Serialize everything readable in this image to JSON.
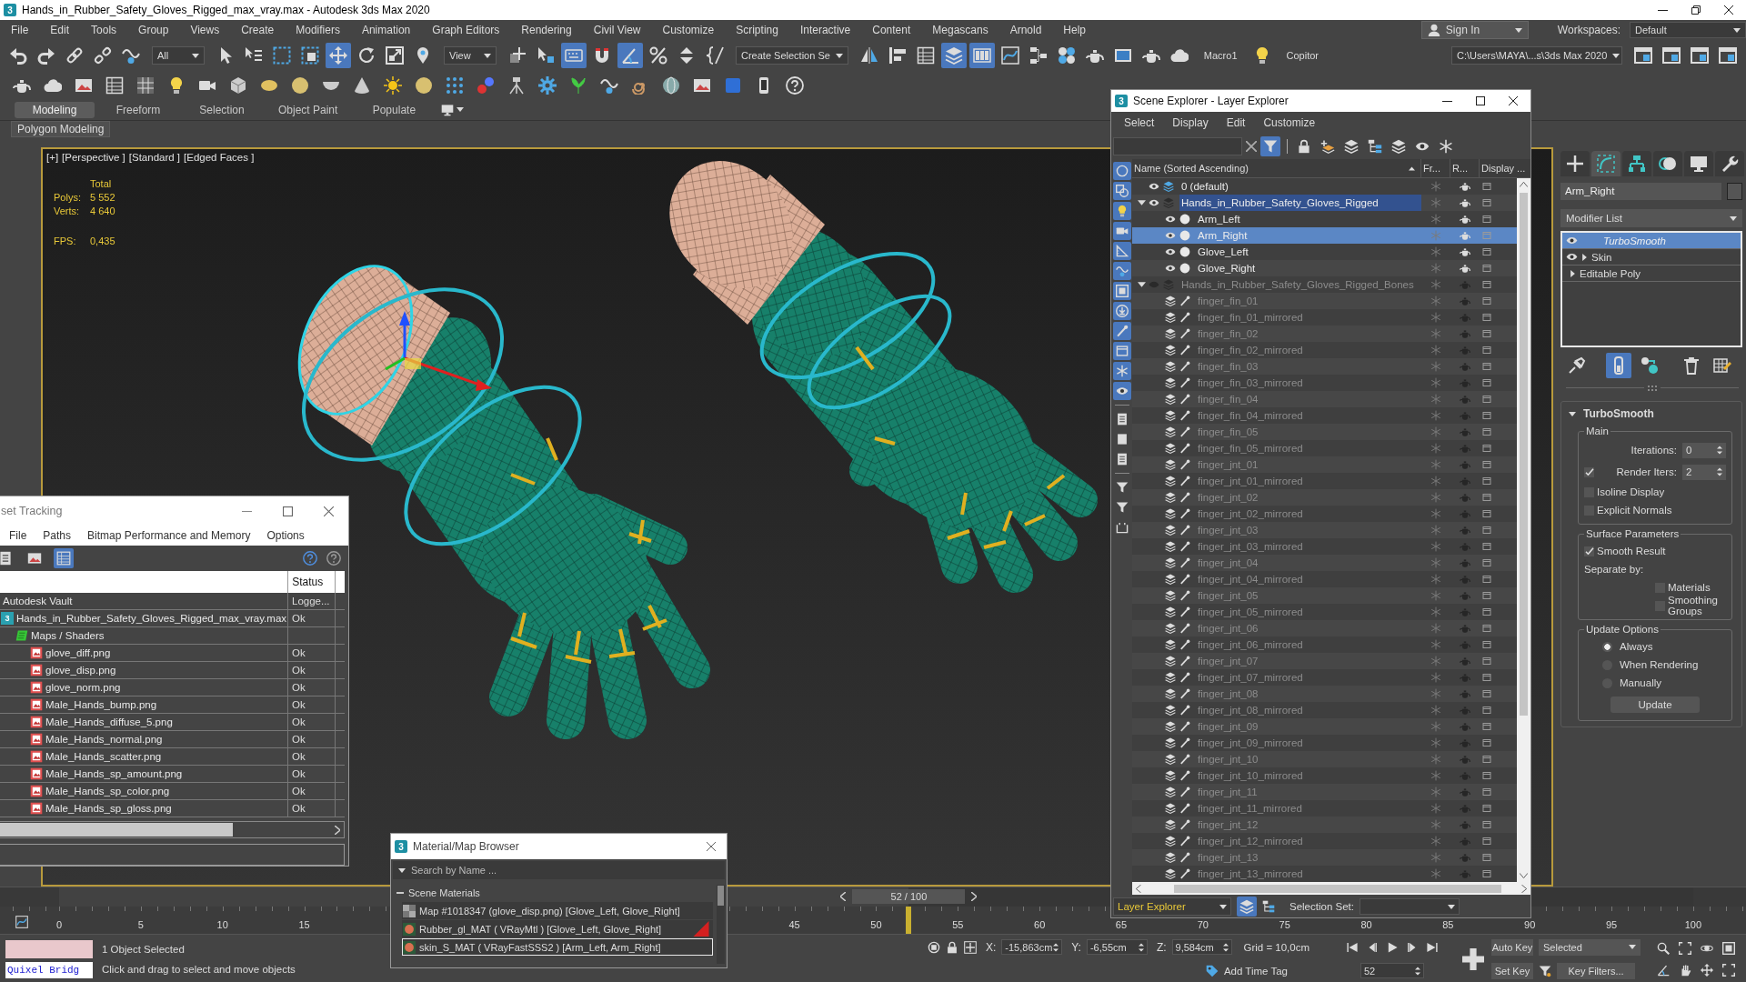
{
  "window": {
    "logo": "3",
    "title": "Hands_in_Rubber_Safety_Gloves_Rigged_max_vray.max - Autodesk 3ds Max 2020"
  },
  "menu": [
    "File",
    "Edit",
    "Tools",
    "Group",
    "Views",
    "Create",
    "Modifiers",
    "Animation",
    "Graph Editors",
    "Rendering",
    "Civil View",
    "Customize",
    "Scripting",
    "Interactive",
    "Content",
    "Megascans",
    "Arnold",
    "Help"
  ],
  "account": {
    "label": "Sign In"
  },
  "workspaces": {
    "label": "Workspaces:",
    "value": "Default"
  },
  "main_toolbar": [
    {
      "kind": "undo",
      "on": false
    },
    {
      "kind": "redo",
      "on": false
    },
    {
      "kind": "link",
      "on": false
    },
    {
      "kind": "unlink",
      "on": false
    },
    {
      "kind": "wave",
      "on": false
    },
    {
      "kind": "dropdown",
      "value": "All",
      "on": false
    },
    {
      "kind": "cursor",
      "on": false
    },
    {
      "kind": "namelist",
      "on": false
    },
    {
      "kind": "rectangle",
      "on": false
    },
    {
      "kind": "crossing",
      "on": false
    },
    {
      "kind": "move",
      "on": true
    },
    {
      "kind": "rotate",
      "on": false
    },
    {
      "kind": "scale",
      "on": false
    },
    {
      "kind": "pin",
      "on": false
    },
    {
      "kind": "dropdown",
      "value": "View",
      "on": false
    },
    {
      "kind": "pivot",
      "on": false
    },
    {
      "kind": "pointer",
      "on": false
    },
    {
      "kind": "keyboard",
      "on": true
    },
    {
      "kind": "magnet",
      "on": false
    },
    {
      "kind": "angle",
      "on": true
    },
    {
      "kind": "percent",
      "on": false
    },
    {
      "kind": "arrows",
      "on": false
    },
    {
      "kind": "braces",
      "on": false
    },
    {
      "kind": "dropdown",
      "value": "Create Selection Se",
      "on": false
    },
    {
      "kind": "mirror",
      "on": false
    },
    {
      "kind": "align",
      "on": false
    },
    {
      "kind": "table",
      "on": false
    },
    {
      "kind": "layers",
      "on": true
    },
    {
      "kind": "panels",
      "on": true
    },
    {
      "kind": "curve",
      "on": false
    },
    {
      "kind": "graph",
      "on": false
    },
    {
      "kind": "spheres",
      "on": false
    },
    {
      "kind": "teapot",
      "on": false
    },
    {
      "kind": "frame",
      "on": false
    },
    {
      "kind": "teapot",
      "on": false
    },
    {
      "kind": "cloud",
      "on": false
    },
    {
      "kind": "text",
      "value": "Macro1",
      "on": false
    },
    {
      "kind": "bulb",
      "on": false
    },
    {
      "kind": "text",
      "value": "Copitor",
      "on": false
    },
    {
      "kind": "path",
      "value": "C:\\Users\\MAYA\\...s\\3ds Max 2020",
      "on": false
    },
    {
      "kind": "window",
      "on": false
    },
    {
      "kind": "window",
      "on": false
    },
    {
      "kind": "window",
      "on": false
    },
    {
      "kind": "window",
      "on": false
    }
  ],
  "secondary_toolbar": [
    {
      "kind": "teapot"
    },
    {
      "kind": "cloud"
    },
    {
      "kind": "photo"
    },
    {
      "kind": "table"
    },
    {
      "kind": "grid"
    },
    {
      "kind": "bulb"
    },
    {
      "kind": "camera"
    },
    {
      "kind": "cube"
    },
    {
      "kind": "ellipse"
    },
    {
      "kind": "orb"
    },
    {
      "kind": "bowl"
    },
    {
      "kind": "cone"
    },
    {
      "kind": "sun"
    },
    {
      "kind": "orb"
    },
    {
      "kind": "dots"
    },
    {
      "kind": "balls"
    },
    {
      "kind": "tripod"
    },
    {
      "kind": "gear"
    },
    {
      "kind": "plant"
    },
    {
      "kind": "wave"
    },
    {
      "kind": "spiral"
    },
    {
      "kind": "globe"
    },
    {
      "kind": "photo"
    },
    {
      "kind": "square"
    },
    {
      "kind": "phone"
    },
    {
      "kind": "help"
    }
  ],
  "ribbon": {
    "tabs": [
      {
        "label": "Modeling",
        "selected": true
      },
      {
        "label": "Freeform",
        "selected": false
      },
      {
        "label": "Selection",
        "selected": false
      },
      {
        "label": "Object Paint",
        "selected": false
      },
      {
        "label": "Populate",
        "selected": false
      }
    ],
    "panel": "Polygon Modeling"
  },
  "viewport": {
    "active": true,
    "labels": [
      "[+]",
      "[Perspective ]",
      "[Standard ]",
      "[Edged Faces ]"
    ],
    "stats": {
      "header": "Total",
      "rows": [
        {
          "label": "Polys:",
          "value": "5 552"
        },
        {
          "label": "Verts:",
          "value": "4 640"
        }
      ],
      "fps_label": "FPS:",
      "fps_value": "0,435"
    }
  },
  "scene_explorer": {
    "logo": "3",
    "title": "Scene Explorer - Layer Explorer",
    "menu": [
      "Select",
      "Display",
      "Edit",
      "Customize"
    ],
    "toolbar": [
      {
        "kind": "funnel",
        "on": true
      },
      {
        "kind": "lock",
        "on": false
      },
      {
        "kind": "layerplus",
        "on": false
      },
      {
        "kind": "layers",
        "on": false
      },
      {
        "kind": "hierarchy",
        "on": false
      },
      {
        "kind": "layers",
        "on": false
      },
      {
        "kind": "eye",
        "on": false
      },
      {
        "kind": "snowflake",
        "on": false
      }
    ],
    "filters": [
      {
        "kind": "circle",
        "on": true
      },
      {
        "kind": "shapes",
        "on": true
      },
      {
        "kind": "bulb",
        "on": true
      },
      {
        "kind": "camera",
        "on": true
      },
      {
        "kind": "ruler",
        "on": true
      },
      {
        "kind": "wave",
        "on": true
      },
      {
        "kind": "group",
        "on": true
      },
      {
        "kind": "download",
        "on": true
      },
      {
        "kind": "bone",
        "on": true
      },
      {
        "kind": "box",
        "on": true
      },
      {
        "kind": "snowflake",
        "on": true
      },
      {
        "kind": "eye",
        "on": true
      },
      {
        "kind": "page",
        "on": false
      },
      {
        "kind": "blank",
        "on": false
      },
      {
        "kind": "page",
        "on": false
      },
      {
        "kind": "funnel",
        "on": false
      },
      {
        "kind": "funnel",
        "on": false
      },
      {
        "kind": "bracket",
        "on": false
      }
    ],
    "columns": [
      "Name (Sorted Ascending)",
      "Fr...",
      "R...",
      "Display ..."
    ],
    "tree": [
      {
        "kind": "layer",
        "name": "0 (default)",
        "current": true,
        "hidden": false,
        "selected": false
      },
      {
        "kind": "layer",
        "name": "Hands_in_Rubber_Safety_Gloves_Rigged",
        "current": false,
        "hidden": false,
        "selected": false,
        "expanded": true,
        "children": [
          {
            "kind": "object",
            "name": "Arm_Left",
            "hidden": false,
            "selected": false
          },
          {
            "kind": "object",
            "name": "Arm_Right",
            "hidden": false,
            "selected": true
          },
          {
            "kind": "object",
            "name": "Glove_Left",
            "hidden": false,
            "selected": false
          },
          {
            "kind": "object",
            "name": "Glove_Right",
            "hidden": false,
            "selected": false
          }
        ]
      },
      {
        "kind": "layer",
        "name": "Hands_in_Rubber_Safety_Gloves_Rigged_Bones",
        "current": false,
        "hidden": true,
        "selected": false,
        "expanded": true,
        "children": [
          {
            "kind": "bone",
            "name": "finger_fin_01",
            "hidden": true,
            "selected": false
          },
          {
            "kind": "bone",
            "name": "finger_fin_01_mirrored",
            "hidden": true,
            "selected": false
          },
          {
            "kind": "bone",
            "name": "finger_fin_02",
            "hidden": true,
            "selected": false
          },
          {
            "kind": "bone",
            "name": "finger_fin_02_mirrored",
            "hidden": true,
            "selected": false
          },
          {
            "kind": "bone",
            "name": "finger_fin_03",
            "hidden": true,
            "selected": false
          },
          {
            "kind": "bone",
            "name": "finger_fin_03_mirrored",
            "hidden": true,
            "selected": false
          },
          {
            "kind": "bone",
            "name": "finger_fin_04",
            "hidden": true,
            "selected": false
          },
          {
            "kind": "bone",
            "name": "finger_fin_04_mirrored",
            "hidden": true,
            "selected": false
          },
          {
            "kind": "bone",
            "name": "finger_fin_05",
            "hidden": true,
            "selected": false
          },
          {
            "kind": "bone",
            "name": "finger_fin_05_mirrored",
            "hidden": true,
            "selected": false
          },
          {
            "kind": "bone",
            "name": "finger_jnt_01",
            "hidden": true,
            "selected": false
          },
          {
            "kind": "bone",
            "name": "finger_jnt_01_mirrored",
            "hidden": true,
            "selected": false
          },
          {
            "kind": "bone",
            "name": "finger_jnt_02",
            "hidden": true,
            "selected": false
          },
          {
            "kind": "bone",
            "name": "finger_jnt_02_mirrored",
            "hidden": true,
            "selected": false
          },
          {
            "kind": "bone",
            "name": "finger_jnt_03",
            "hidden": true,
            "selected": false
          },
          {
            "kind": "bone",
            "name": "finger_jnt_03_mirrored",
            "hidden": true,
            "selected": false
          },
          {
            "kind": "bone",
            "name": "finger_jnt_04",
            "hidden": true,
            "selected": false
          },
          {
            "kind": "bone",
            "name": "finger_jnt_04_mirrored",
            "hidden": true,
            "selected": false
          },
          {
            "kind": "bone",
            "name": "finger_jnt_05",
            "hidden": true,
            "selected": false
          },
          {
            "kind": "bone",
            "name": "finger_jnt_05_mirrored",
            "hidden": true,
            "selected": false
          },
          {
            "kind": "bone",
            "name": "finger_jnt_06",
            "hidden": true,
            "selected": false
          },
          {
            "kind": "bone",
            "name": "finger_jnt_06_mirrored",
            "hidden": true,
            "selected": false
          },
          {
            "kind": "bone",
            "name": "finger_jnt_07",
            "hidden": true,
            "selected": false
          },
          {
            "kind": "bone",
            "name": "finger_jnt_07_mirrored",
            "hidden": true,
            "selected": false
          },
          {
            "kind": "bone",
            "name": "finger_jnt_08",
            "hidden": true,
            "selected": false
          },
          {
            "kind": "bone",
            "name": "finger_jnt_08_mirrored",
            "hidden": true,
            "selected": false
          },
          {
            "kind": "bone",
            "name": "finger_jnt_09",
            "hidden": true,
            "selected": false
          },
          {
            "kind": "bone",
            "name": "finger_jnt_09_mirrored",
            "hidden": true,
            "selected": false
          },
          {
            "kind": "bone",
            "name": "finger_jnt_10",
            "hidden": true,
            "selected": false
          },
          {
            "kind": "bone",
            "name": "finger_jnt_10_mirrored",
            "hidden": true,
            "selected": false
          },
          {
            "kind": "bone",
            "name": "finger_jnt_11",
            "hidden": true,
            "selected": false
          },
          {
            "kind": "bone",
            "name": "finger_jnt_11_mirrored",
            "hidden": true,
            "selected": false
          },
          {
            "kind": "bone",
            "name": "finger_jnt_12",
            "hidden": true,
            "selected": false
          },
          {
            "kind": "bone",
            "name": "finger_jnt_12_mirrored",
            "hidden": true,
            "selected": false
          },
          {
            "kind": "bone",
            "name": "finger_jnt_13",
            "hidden": true,
            "selected": false
          },
          {
            "kind": "bone",
            "name": "finger_jnt_13_mirrored",
            "hidden": true,
            "selected": false
          }
        ]
      }
    ],
    "footer": {
      "mode": "Layer Explorer",
      "selection_set": "Selection Set:"
    }
  },
  "command_panel": {
    "tabs": [
      {
        "kind": "plus",
        "selected": false
      },
      {
        "kind": "bezier",
        "selected": true
      },
      {
        "kind": "tree",
        "selected": false
      },
      {
        "kind": "circles",
        "selected": false
      },
      {
        "kind": "monitor",
        "selected": false
      },
      {
        "kind": "wrench",
        "selected": false
      }
    ],
    "object_name": "Arm_Right",
    "modifier_list": "Modifier List",
    "stack": [
      {
        "kind": "modifier",
        "name": "TurboSmooth",
        "selected": true,
        "viewport_off": true
      },
      {
        "kind": "modifier",
        "name": "Skin",
        "selected": false,
        "viewport_off": false,
        "expanded": false
      },
      {
        "kind": "base",
        "name": "Editable Poly",
        "selected": false,
        "viewport_off": false,
        "expanded": false
      }
    ],
    "stack_tools": [
      {
        "kind": "pushpin",
        "on": false
      },
      {
        "kind": "tube",
        "on": true
      },
      {
        "kind": "nodes",
        "on": false
      },
      {
        "kind": "trash",
        "on": false
      },
      {
        "kind": "gridpencil",
        "on": false
      }
    ],
    "rollout": {
      "title": "TurboSmooth",
      "expanded": true,
      "groups": [
        {
          "title": "Main",
          "controls": [
            {
              "kind": "spinner",
              "label": "Iterations:",
              "value": "0"
            },
            {
              "kind": "spinner",
              "label": "Render Iters:",
              "value": "2",
              "checked": true
            },
            {
              "kind": "checkbox",
              "label": "Isoline Display",
              "checked": false
            },
            {
              "kind": "checkbox",
              "label": "Explicit Normals",
              "checked": false
            }
          ]
        },
        {
          "title": "Surface Parameters",
          "controls": [
            {
              "kind": "checkbox",
              "label": "Smooth Result",
              "checked": true
            },
            {
              "kind": "label",
              "label": "Separate by:",
              "children": [
                {
                  "kind": "checkbox",
                  "label": "Materials",
                  "checked": false
                },
                {
                  "kind": "checkbox",
                  "label": "Smoothing Groups",
                  "checked": false
                }
              ]
            }
          ]
        },
        {
          "title": "Update Options",
          "controls": [
            {
              "kind": "radio",
              "label": "Always",
              "selected": true
            },
            {
              "kind": "radio",
              "label": "When Rendering",
              "selected": false
            },
            {
              "kind": "radio",
              "label": "Manually",
              "selected": false
            },
            {
              "kind": "button",
              "label": "Update"
            }
          ]
        }
      ]
    }
  },
  "asset_tracking": {
    "title": "set Tracking",
    "menu": [
      "File",
      "Paths",
      "Bitmap Performance and Memory",
      "Options"
    ],
    "toolbar": [
      {
        "kind": "page",
        "on": false
      },
      {
        "kind": "photo",
        "on": false
      },
      {
        "kind": "table",
        "on": true
      }
    ],
    "status_header": "Status",
    "rows": [
      {
        "kind": "vault",
        "name": "Autodesk Vault",
        "status": "Logge..."
      },
      {
        "kind": "scene",
        "icon_text": "3",
        "name": "Hands_in_Rubber_Safety_Gloves_Rigged_max_vray.max",
        "status": "Ok",
        "children": [
          {
            "kind": "folder",
            "name": "Maps / Shaders",
            "children": [
              {
                "kind": "image",
                "name": "glove_diff.png",
                "status": "Ok"
              },
              {
                "kind": "image",
                "name": "glove_disp.png",
                "status": "Ok"
              },
              {
                "kind": "image",
                "name": "glove_norm.png",
                "status": "Ok"
              },
              {
                "kind": "image",
                "name": "Male_Hands_bump.png",
                "status": "Ok"
              },
              {
                "kind": "image",
                "name": "Male_Hands_diffuse_5.png",
                "status": "Ok"
              },
              {
                "kind": "image",
                "name": "Male_Hands_normal.png",
                "status": "Ok"
              },
              {
                "kind": "image",
                "name": "Male_Hands_scatter.png",
                "status": "Ok"
              },
              {
                "kind": "image",
                "name": "Male_Hands_sp_amount.png",
                "status": "Ok"
              },
              {
                "kind": "image",
                "name": "Male_Hands_sp_color.png",
                "status": "Ok"
              },
              {
                "kind": "image",
                "name": "Male_Hands_sp_gloss.png",
                "status": "Ok"
              }
            ]
          }
        ]
      }
    ]
  },
  "material_browser": {
    "logo": "3",
    "title": "Material/Map Browser",
    "search_placeholder": "Search by Name ...",
    "section": {
      "title": "Scene Materials",
      "expanded": true,
      "items": [
        {
          "kind": "map",
          "name": "Map #1018347 (glove_disp.png) [Glove_Left, Glove_Right]",
          "selected": false,
          "in_viewport": false
        },
        {
          "kind": "material",
          "name": "Rubber_gl_MAT ( VRayMtl ) [Glove_Left, Glove_Right]",
          "selected": false,
          "in_viewport": true
        },
        {
          "kind": "material",
          "name": "skin_S_MAT ( VRayFastSSS2 ) [Arm_Left, Arm_Right]",
          "selected": true,
          "in_viewport": false
        }
      ]
    }
  },
  "timeline": {
    "frame_label": "52 / 100",
    "level": 0.52,
    "ruler": [
      [
        "0",
        "5",
        "10",
        "15"
      ],
      [
        "45",
        "50",
        "55",
        "60",
        "65",
        "70",
        "75",
        "80",
        "85",
        "90",
        "95",
        "100"
      ]
    ]
  },
  "status_bar": {
    "script_field": "Quixel Bridg",
    "selection": "1 Object Selected",
    "prompt": "Click and drag to select and move objects",
    "coordinates": [
      {
        "axis": "X:",
        "value": "-15,863cm"
      },
      {
        "axis": "Y:",
        "value": "-6,55cm"
      },
      {
        "axis": "Z:",
        "value": "9,584cm"
      }
    ],
    "grid": "Grid = 10,0cm",
    "time_tag": "Add Time Tag",
    "current_frame": "52",
    "auto_key": "Auto Key",
    "key_mode": "Selected",
    "set_key": "Set Key",
    "key_filters": "Key Filters..."
  }
}
